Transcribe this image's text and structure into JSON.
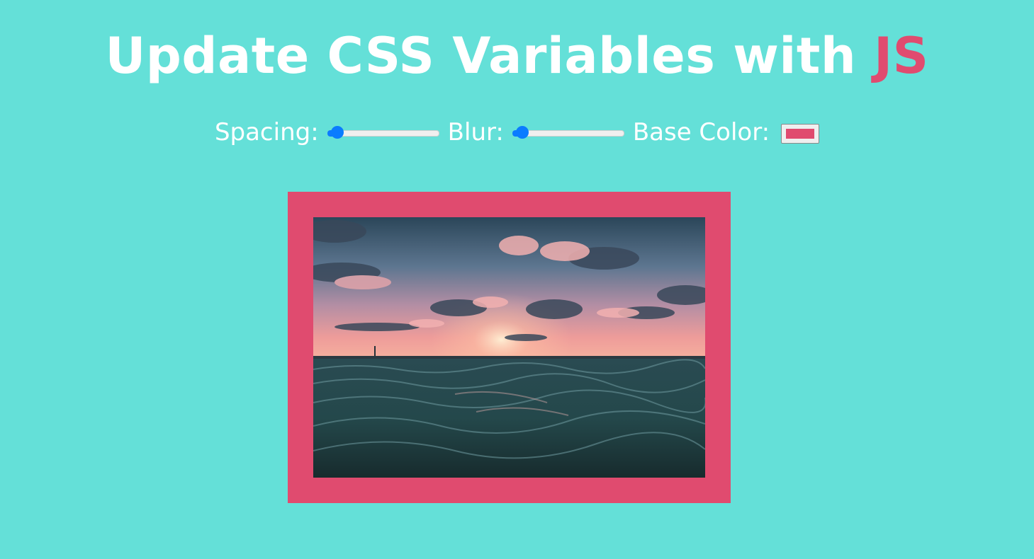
{
  "header": {
    "title_main": "Update CSS Variables with ",
    "title_highlight": "JS"
  },
  "controls": {
    "spacing_label": "Spacing:",
    "spacing_value": 10,
    "spacing_min": 10,
    "spacing_max": 200,
    "blur_label": "Blur:",
    "blur_value": 0,
    "blur_min": 0,
    "blur_max": 25,
    "base_color_label": "Base Color:",
    "base_color_value": "#e04b6f"
  },
  "colors": {
    "background": "#64e0d8",
    "accent": "#e04b6f",
    "slider_accent": "#0a7cff",
    "text": "#ffffff"
  },
  "image": {
    "subject": "sunset over ocean waves"
  }
}
